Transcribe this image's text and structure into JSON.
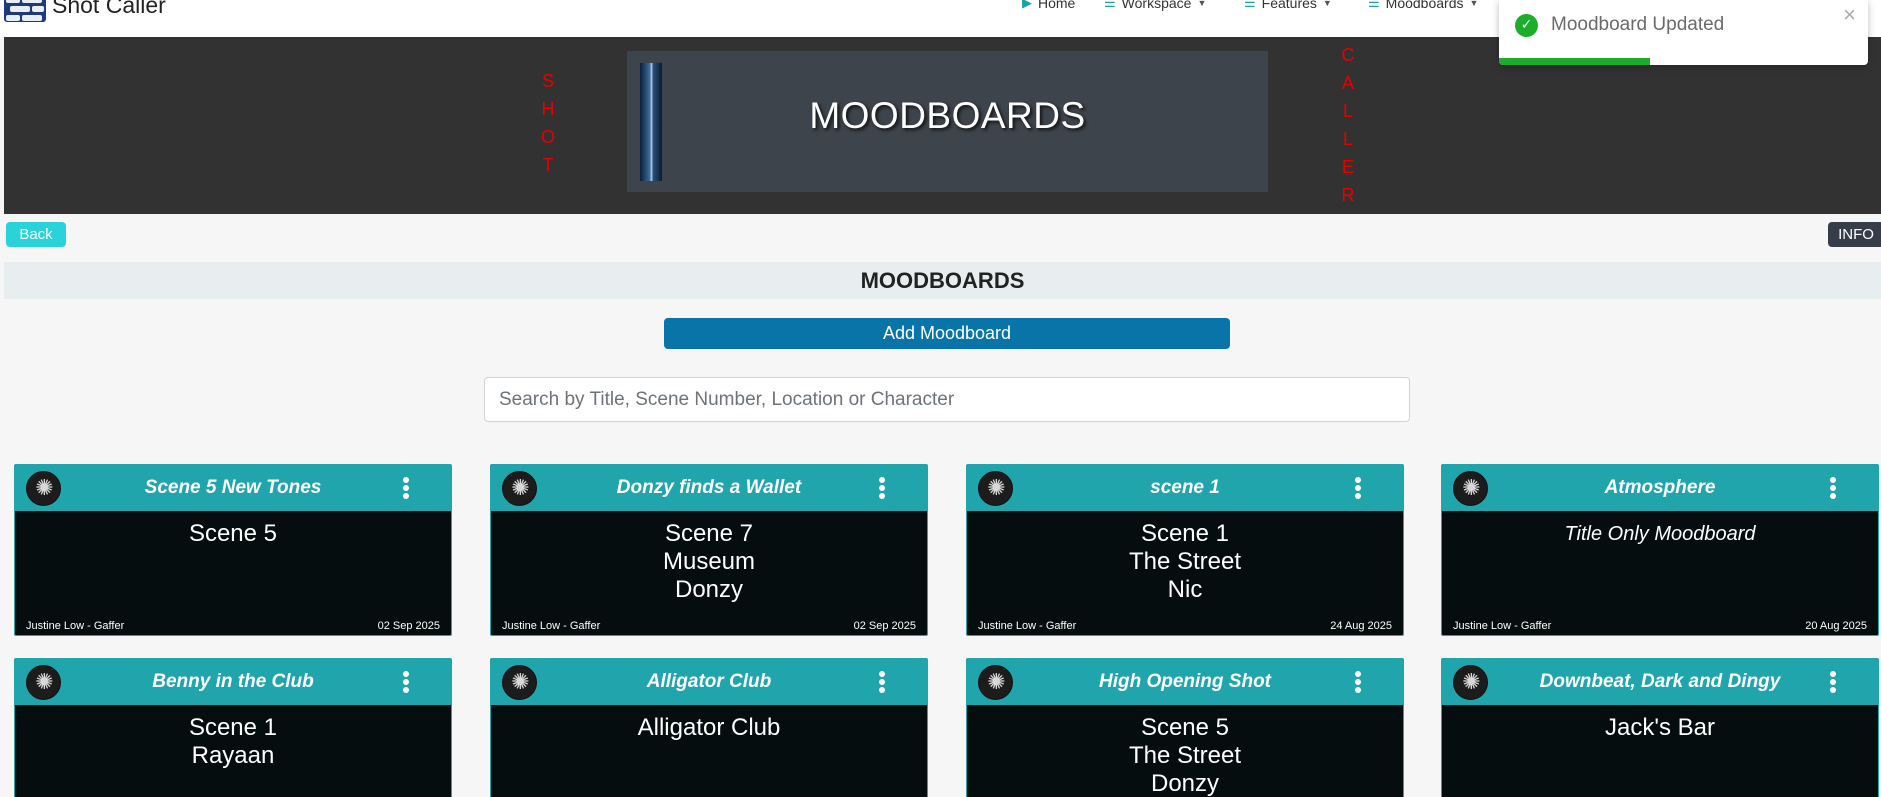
{
  "app": {
    "title": "Shot Caller"
  },
  "nav": {
    "items": [
      {
        "label": "Home",
        "icon": "play-icon",
        "dropdown": false
      },
      {
        "label": "Workspace",
        "icon": "menu-icon",
        "dropdown": true
      },
      {
        "label": "Features",
        "icon": "menu-icon",
        "dropdown": true
      },
      {
        "label": "Moodboards",
        "icon": "menu-icon",
        "dropdown": true
      }
    ]
  },
  "banner": {
    "left_letters": [
      "S",
      "H",
      "O",
      "T"
    ],
    "right_letters": [
      "C",
      "A",
      "L",
      "L",
      "E",
      "R"
    ],
    "title": "MOODBOARDS",
    "letter_color": "#e60000"
  },
  "buttons": {
    "back": "Back",
    "info": "INFO",
    "add": "Add Moodboard"
  },
  "section": {
    "title": "MOODBOARDS"
  },
  "search": {
    "placeholder": "Search by Title, Scene Number, Location or Character",
    "value": ""
  },
  "cards": [
    {
      "title": "Scene 5 New Tones",
      "lines": [
        "Scene 5"
      ],
      "italic": false,
      "author": "Justine Low - Gaffer",
      "date": "02 Sep 2025"
    },
    {
      "title": "Donzy finds a Wallet",
      "lines": [
        "Scene 7",
        "Museum",
        "Donzy"
      ],
      "italic": false,
      "author": "Justine Low - Gaffer",
      "date": "02 Sep 2025"
    },
    {
      "title": "scene 1",
      "lines": [
        "Scene 1",
        "The Street",
        "Nic"
      ],
      "italic": false,
      "author": "Justine Low - Gaffer",
      "date": "24 Aug 2025"
    },
    {
      "title": "Atmosphere",
      "lines": [
        "Title Only Moodboard"
      ],
      "italic": true,
      "author": "Justine Low - Gaffer",
      "date": "20 Aug 2025"
    },
    {
      "title": "Benny in the Club",
      "lines": [
        "Scene 1",
        "Rayaan"
      ],
      "italic": false,
      "author": "",
      "date": ""
    },
    {
      "title": "Alligator Club",
      "lines": [
        "Alligator Club"
      ],
      "italic": false,
      "author": "",
      "date": ""
    },
    {
      "title": "High Opening Shot",
      "lines": [
        "Scene 5",
        "The Street",
        "Donzy"
      ],
      "italic": false,
      "author": "",
      "date": ""
    },
    {
      "title": "Downbeat, Dark and Dingy",
      "lines": [
        "Jack's Bar"
      ],
      "italic": false,
      "author": "",
      "date": ""
    }
  ],
  "toast": {
    "message": "Moodboard Updated",
    "close": "×",
    "progress": 0.41,
    "accent": "#1aae2a"
  },
  "colors": {
    "teal": "#20a5ad",
    "add_button": "#0874a8",
    "back_button": "#2ad3d9",
    "info_button": "#363d48"
  }
}
